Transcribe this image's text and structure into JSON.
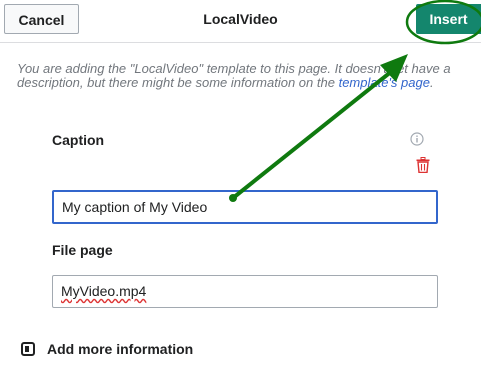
{
  "header": {
    "cancel_label": "Cancel",
    "title": "LocalVideo",
    "insert_label": "Insert"
  },
  "intro": {
    "text_before": "You are adding the \"LocalVideo\" template to this page. It doesn't yet have a description, but there might be some information on the ",
    "link_text": "template's page",
    "text_after": "."
  },
  "fields": {
    "caption_label": "Caption",
    "caption_value": "My caption of My Video",
    "file_label": "File page",
    "file_value": "MyVideo.mp4"
  },
  "more_info_label": "Add more information",
  "colors": {
    "progressive": "#14866d",
    "annotation": "#0f7a0f",
    "focus": "#3366cc",
    "destructive": "#d33"
  },
  "icons": {
    "info": "info-icon",
    "delete": "trash-icon",
    "more": "checkbox-icon"
  }
}
